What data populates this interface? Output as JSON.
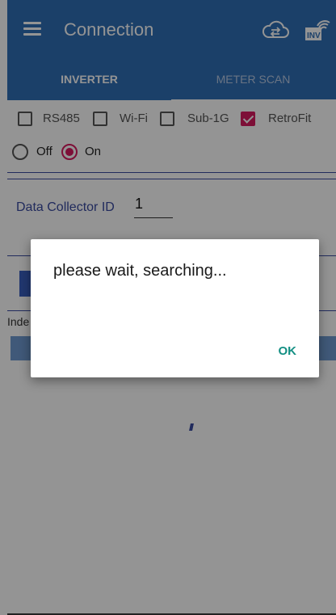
{
  "appbar": {
    "title": "Connection",
    "cloud_icon": "cloud-sync-icon",
    "inv_icon": "inverter-wifi-icon",
    "inv_text": "INV"
  },
  "tabs": [
    {
      "label": "INVERTER",
      "active": true
    },
    {
      "label": "METER SCAN",
      "active": false
    }
  ],
  "checkboxes": [
    {
      "label": "RS485",
      "checked": false
    },
    {
      "label": "Wi-Fi",
      "checked": false
    },
    {
      "label": "Sub-1G",
      "checked": false
    },
    {
      "label": "RetroFit",
      "checked": true
    }
  ],
  "radios": [
    {
      "label": "Off",
      "selected": false
    },
    {
      "label": "On",
      "selected": true
    }
  ],
  "data_collector": {
    "label": "Data Collector ID",
    "value": "1"
  },
  "index_label": "Inde",
  "dialog": {
    "message": "please wait, searching...",
    "ok_label": "OK"
  },
  "colors": {
    "primary": "#2f6eb5",
    "accent": "#d81b60",
    "dialog_button": "#138f83"
  }
}
